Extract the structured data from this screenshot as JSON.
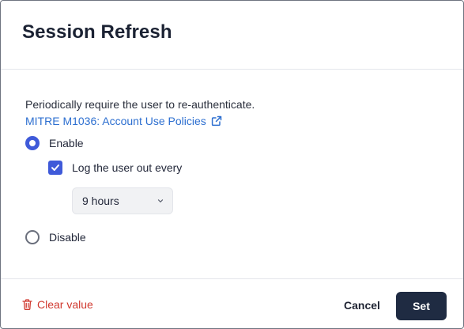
{
  "dialog": {
    "title": "Session Refresh",
    "description": "Periodically require the user to re-authenticate.",
    "link_text": "MITRE M1036: Account Use Policies",
    "link_icon": "external-link-icon"
  },
  "options": {
    "enable_label": "Enable",
    "enable_selected": true,
    "logout_label": "Log the user out every",
    "logout_checked": true,
    "duration_value": "9 hours",
    "disable_label": "Disable"
  },
  "footer": {
    "clear_label": "Clear value",
    "clear_icon": "trash-icon",
    "cancel_label": "Cancel",
    "set_label": "Set"
  },
  "colors": {
    "accent": "#3f5ad9",
    "link": "#2d6fd0",
    "danger": "#d0392f",
    "primary_button": "#1f2b42"
  }
}
